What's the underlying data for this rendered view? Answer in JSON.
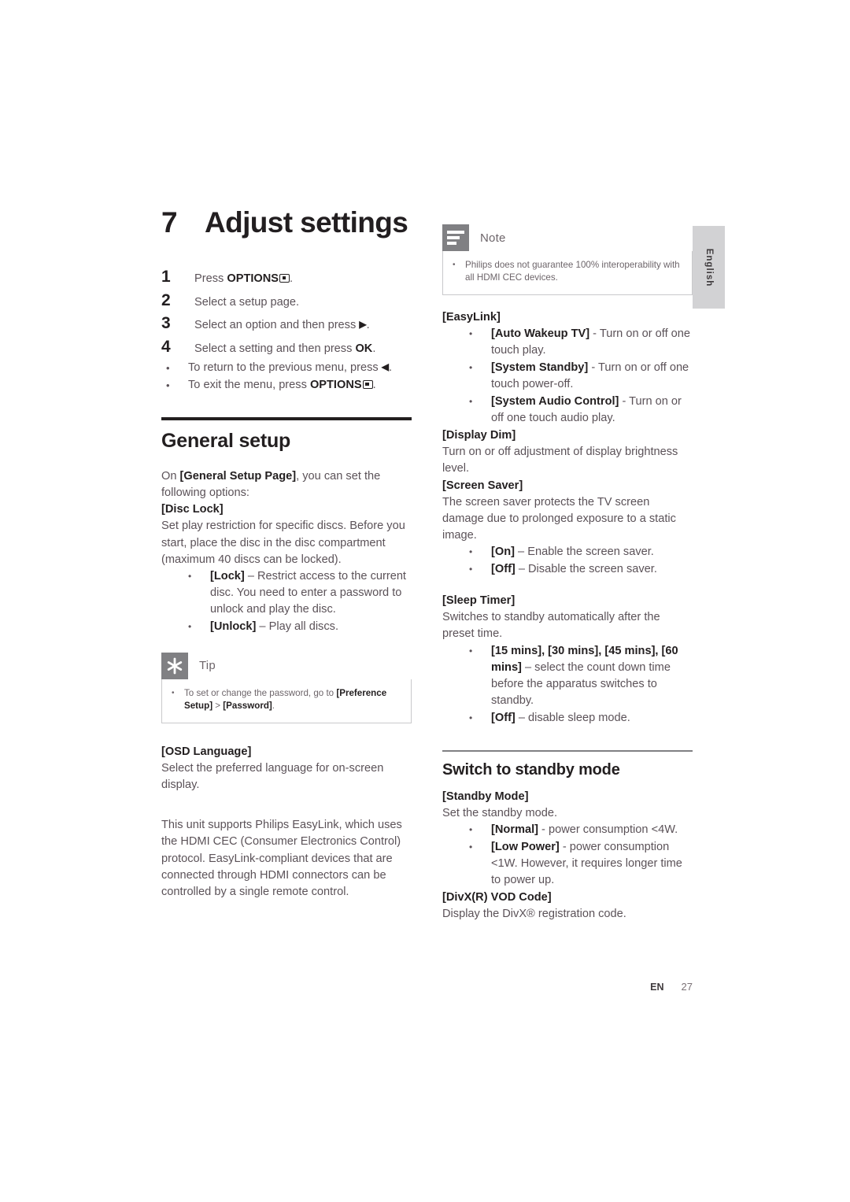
{
  "chapter": {
    "number": "7",
    "title": "Adjust settings"
  },
  "steps": [
    {
      "num": "1",
      "pre": "Press ",
      "bold": "OPTIONS",
      "icon": "options-key-icon",
      "post": "."
    },
    {
      "num": "2",
      "pre": "Select a setup page.",
      "bold": "",
      "post": ""
    },
    {
      "num": "3",
      "pre": "Select an option and then press ",
      "bold": "",
      "arrow": "▶",
      "post": "."
    },
    {
      "num": "4",
      "pre": "Select a setting and then press ",
      "bold": "OK",
      "post": "."
    }
  ],
  "step_bullets": [
    {
      "pre": "To return to the previous menu, press ",
      "arrow": "◀",
      "post": "."
    },
    {
      "pre": "To exit the menu, press ",
      "bold": "OPTIONS",
      "icon": "options-key-icon",
      "post": "."
    }
  ],
  "general_setup": {
    "heading": "General setup",
    "intro_pre": "On ",
    "intro_bold": "[General Setup Page]",
    "intro_post": ", you can set the following options:",
    "disc_lock": {
      "heading": "[Disc Lock]",
      "body": "Set play restriction for specific discs. Before you start, place the disc in the disc compartment (maximum 40 discs can be locked).",
      "options": [
        {
          "label": "[Lock]",
          "text": " – Restrict access to the current disc. You need to enter a password to unlock and play the disc."
        },
        {
          "label": "[Unlock]",
          "text": " – Play all discs."
        }
      ]
    },
    "tip": {
      "label": "Tip",
      "icon": "tip-asterisk-icon",
      "text_pre": "To set or change the password, go to ",
      "text_bold1": "[Preference Setup]",
      "text_mid": " > ",
      "text_bold2": "[Password]",
      "text_post": "."
    },
    "osd_language": {
      "heading": "[OSD Language]",
      "body": "Select the preferred language for on-screen display."
    },
    "easylink_intro": "This unit supports Philips EasyLink, which uses the HDMI CEC (Consumer Electronics Control) protocol. EasyLink-compliant devices that are connected through HDMI connectors can be controlled by a single remote control."
  },
  "note": {
    "label": "Note",
    "icon": "note-lines-icon",
    "text": "Philips does not guarantee 100% interoperability with all HDMI CEC devices."
  },
  "easylink": {
    "heading": "[EasyLink]",
    "options": [
      {
        "label": "[Auto Wakeup TV]",
        "text": " - Turn on or off one touch play."
      },
      {
        "label": "[System Standby]",
        "text": " - Turn on or off one touch power-off."
      },
      {
        "label": "[System Audio Control]",
        "text": " - Turn on or off one touch audio play."
      }
    ]
  },
  "display_dim": {
    "heading": "[Display Dim]",
    "body": "Turn on or off adjustment of display brightness level."
  },
  "screen_saver": {
    "heading": "[Screen Saver]",
    "body": "The screen saver protects the TV screen damage due to prolonged exposure to a static image.",
    "options": [
      {
        "label": "[On]",
        "text": " – Enable the screen saver."
      },
      {
        "label": "[Off]",
        "text": " – Disable the screen saver."
      }
    ]
  },
  "sleep_timer": {
    "heading": "[Sleep Timer]",
    "body": "Switches to standby automatically after the preset time.",
    "options": [
      {
        "label": "[15 mins], [30 mins], [45 mins], [60 mins]",
        "text": " – select the count down time before the apparatus switches to standby."
      },
      {
        "label": "[Off]",
        "text": " – disable sleep mode."
      }
    ]
  },
  "standby": {
    "heading": "Switch to standby mode",
    "standby_mode": {
      "heading": "[Standby Mode]",
      "body": "Set the standby mode.",
      "options": [
        {
          "label": "[Normal]",
          "text": " - power consumption <4W."
        },
        {
          "label": "[Low Power]",
          "text": " - power consumption <1W. However, it requires longer time to power up."
        }
      ]
    },
    "divx": {
      "heading": "[DivX(R) VOD Code]",
      "body": "Display the DivX® registration code."
    }
  },
  "lang_tab": "English",
  "footer": {
    "lang": "EN",
    "page": "27"
  },
  "colors": {
    "body_text": "#5b5258",
    "heading": "#231f20",
    "callout_gray": "#808083",
    "tab_gray": "#d2d2d4"
  }
}
